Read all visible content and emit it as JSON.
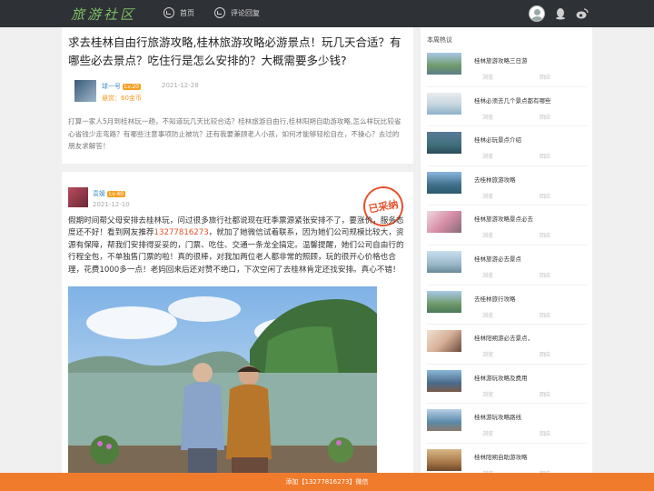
{
  "header": {
    "logo": "旅游社区",
    "nav": [
      {
        "label": "首页",
        "icon": "home-icon"
      },
      {
        "label": "评论回复",
        "icon": "comment-icon"
      }
    ]
  },
  "question": {
    "title": "求去桂林自由行旅游攻略,桂林旅游攻略必游景点！玩几天合适？有哪些必去景点？吃住行是怎么安排的？大概需要多少钱?",
    "user": {
      "name": "球一号",
      "level": "Lv.20",
      "date": "2021-12-28",
      "reward": "悬赏：60金币"
    },
    "body": "打算一家人5月到桂林玩一趟，不知道玩几天比较合适？桂林旅游自由行,桂林阳朔自助游攻略,怎么样玩比较省心省钱少走弯路？有哪些注意事项防止被坑？还有我要兼顾老人小孩，如何才能够轻松自在，不操心？去过的朋友求解答！"
  },
  "answer": {
    "user": {
      "name": "袁媛",
      "level": "Lv.40",
      "date": "2021-12-10"
    },
    "stamp": "已采纳",
    "body_before": "假期时间帮父母安排去桂林玩，问过很多旅行社都说现在旺季票源紧张安排不了，要涨价，服务态度还不好！看到网友推荐",
    "phone": "13277816273",
    "body_after": "，就加了她微信试着联系，因为她们公司规模比较大，资源有保障，帮我们安排得妥妥的，门票、吃住、交通一条龙全搞定。温馨提醒，她们公司自由行的行程全包，不单独售门票的啦！真的很棒，对我加两位老人都非常的照顾，玩的很开心价格也合理，花费1000多一点！老妈回来后还对赞不绝口，下次空闲了去桂林肯定还找安排。真心不错！"
  },
  "sidebar": {
    "title": "本周热议",
    "items": [
      {
        "title": "桂林旅游攻略三日游",
        "views": "浏览",
        "replies": "回应"
      },
      {
        "title": "桂林必须去几个景点都有哪些",
        "views": "浏览",
        "replies": "回应"
      },
      {
        "title": "桂林必玩景点介绍",
        "views": "浏览",
        "replies": "回应"
      },
      {
        "title": "去桂林旅游攻略",
        "views": "浏览",
        "replies": "回应"
      },
      {
        "title": "桂林旅游攻略景点必去",
        "views": "浏览",
        "replies": "回应"
      },
      {
        "title": "桂林旅游必去景点",
        "views": "浏览",
        "replies": "回应"
      },
      {
        "title": "去桂林旅行攻略",
        "views": "浏览",
        "replies": "回应"
      },
      {
        "title": "桂林阳朔游必去景点，",
        "views": "浏览",
        "replies": "回应"
      },
      {
        "title": "桂林游玩攻略及费用",
        "views": "浏览",
        "replies": "回应"
      },
      {
        "title": "桂林游玩攻略路线",
        "views": "浏览",
        "replies": "回应"
      },
      {
        "title": "桂林阳朔自助游攻略",
        "views": "浏览",
        "replies": "回应"
      }
    ]
  },
  "footer": {
    "text": "添加【13277816273】微信"
  },
  "colors": {
    "topbar": "#2e3136",
    "accent": "#f07b2c",
    "link": "#4a90c8",
    "phone": "#e8502a"
  }
}
